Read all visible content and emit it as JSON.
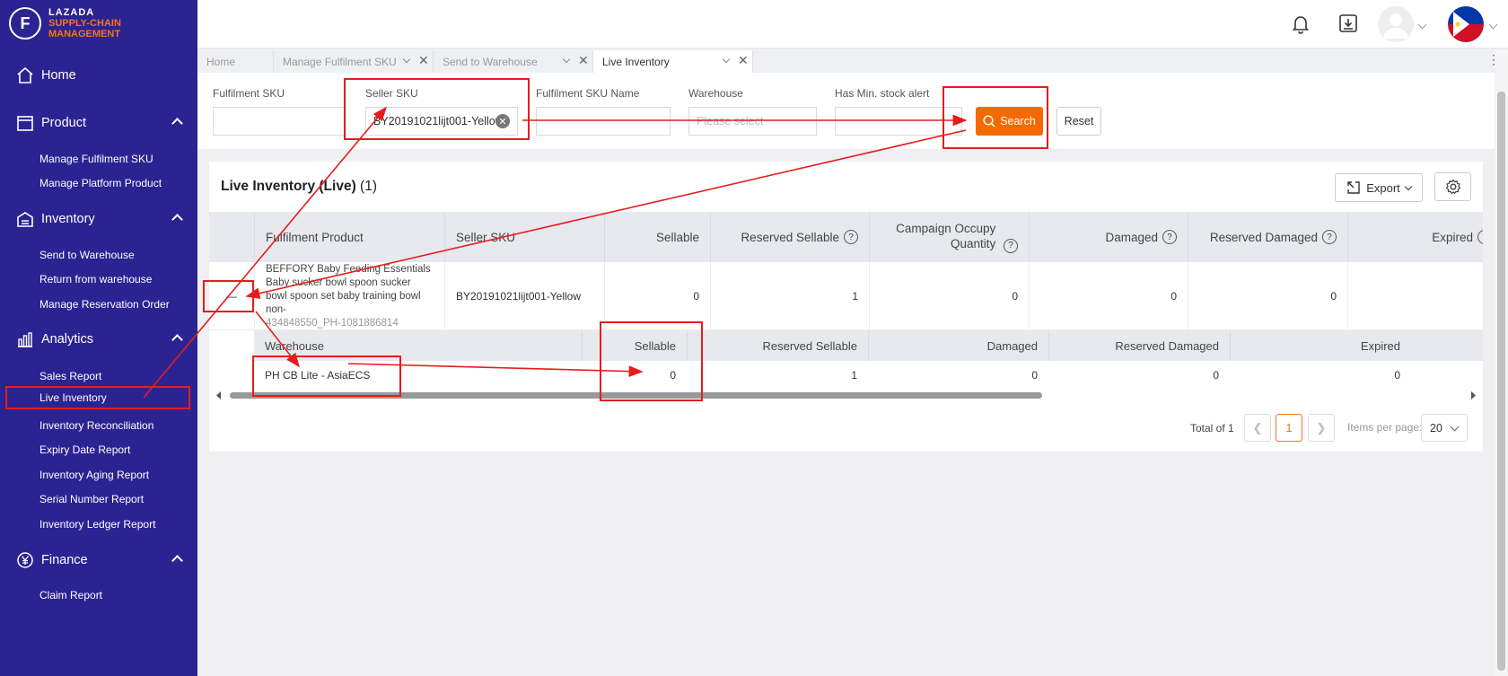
{
  "brand": {
    "line1": "LAZADA",
    "line2": "SUPPLY-CHAIN",
    "line3": "MANAGEMENT",
    "logo_letter": "F",
    "accent": "#f57224",
    "sidebar_bg": "#2b2392"
  },
  "sidebar": {
    "home": "Home",
    "product": {
      "label": "Product",
      "items": [
        "Manage Fulfilment SKU",
        "Manage Platform Product"
      ]
    },
    "inventory": {
      "label": "Inventory",
      "items": [
        "Send to Warehouse",
        "Return from warehouse",
        "Manage Reservation Order"
      ]
    },
    "analytics": {
      "label": "Analytics",
      "items": [
        "Sales Report",
        "Live Inventory",
        "Inventory Reconciliation",
        "Expiry Date Report",
        "Inventory Aging Report",
        "Serial Number Report",
        "Inventory Ledger Report"
      ]
    },
    "finance": {
      "label": "Finance",
      "items": [
        "Claim Report"
      ]
    }
  },
  "header": {
    "icons": [
      "bell-icon",
      "download-icon",
      "avatar",
      "philippines-flag-icon"
    ]
  },
  "tabs": [
    {
      "label": "Home"
    },
    {
      "label": "Manage Fulfilment SKU"
    },
    {
      "label": "Send to Warehouse"
    },
    {
      "label": "Live Inventory"
    }
  ],
  "filters": {
    "fulfilment_sku": {
      "label": "Fulfilment SKU",
      "value": ""
    },
    "seller_sku": {
      "label": "Seller SKU",
      "value": "BY20191021lijt001-Yellow"
    },
    "fulfilment_sku_name": {
      "label": "Fulfilment SKU Name",
      "value": ""
    },
    "warehouse": {
      "label": "Warehouse",
      "placeholder": "Please select"
    },
    "min_stock_alert": {
      "label": "Has Min. stock alert",
      "value": ""
    },
    "search_label": "Search",
    "reset_label": "Reset"
  },
  "table": {
    "title": "Live Inventory (Live)",
    "count": "(1)",
    "export_label": "Export",
    "columns": [
      "Fulfilment Product",
      "Seller SKU",
      "Sellable",
      "Reserved Sellable",
      "Campaign Occupy Quantity",
      "Damaged",
      "Reserved Damaged",
      "Expired"
    ],
    "row": {
      "expand": "—",
      "product_name": "BEFFORY Baby Feeding Essentials Baby sucker bowl spoon sucker bowl spoon set baby training bowl non-",
      "product_id": "434848550_PH-1081886814",
      "seller_sku": "BY20191021lijt001-Yellow",
      "sellable": "0",
      "reserved_sellable": "1",
      "campaign_occupy": "0",
      "damaged": "0",
      "reserved_damaged": "0"
    },
    "sub_columns": [
      "Warehouse",
      "Sellable",
      "Reserved Sellable",
      "Damaged",
      "Reserved Damaged",
      "Expired"
    ],
    "sub_row": {
      "warehouse": "PH CB Lite - AsiaECS",
      "sellable": "0",
      "reserved_sellable": "1",
      "damaged": "0",
      "reserved_damaged": "0",
      "expired": "0"
    }
  },
  "pagination": {
    "total": "Total of 1",
    "page": "1",
    "ipp_label": "Items per page:",
    "ipp_value": "20"
  }
}
